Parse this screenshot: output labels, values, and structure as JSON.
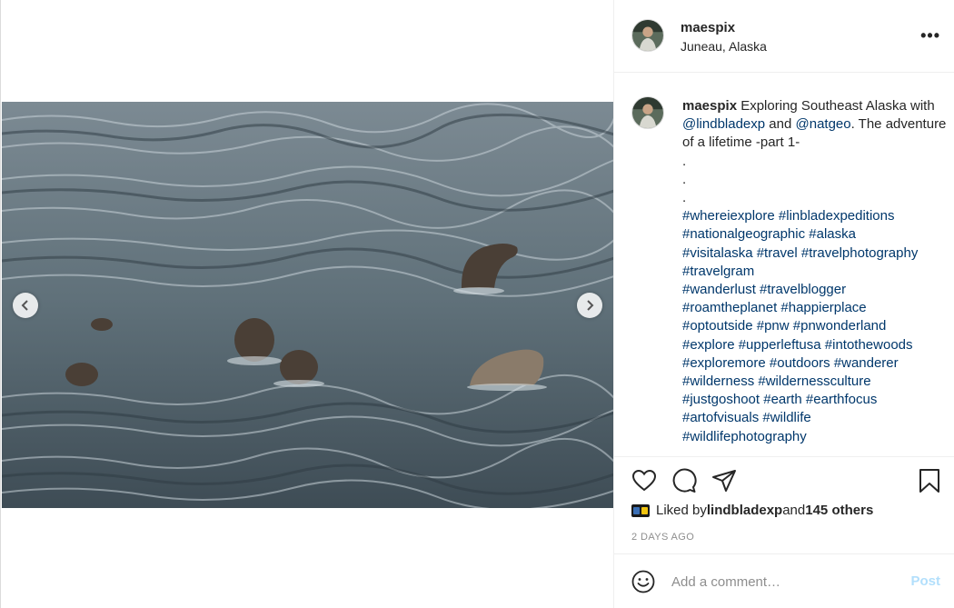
{
  "post": {
    "username": "maespix",
    "location": "Juneau, Alaska",
    "more_label": "•••"
  },
  "caption": {
    "username": "maespix",
    "text_1": " Exploring Southeast Alaska with ",
    "mention_1": "@lindbladexp",
    "text_2": " and ",
    "mention_2": "@natgeo",
    "text_3": ". The adventure of a lifetime -part 1-",
    "dots": [
      ".",
      ".",
      "."
    ],
    "hashtag_lines": [
      "#whereiexplore #linbladexpeditions",
      "#nationalgeographic #alaska",
      "#visitalaska #travel #travelphotography",
      "#travelgram",
      "#wanderlust #travelblogger",
      "#roamtheplanet #happierplace",
      "#optoutside #pnw #pnwonderland",
      "#explore #upperleftusa #intothewoods",
      "#exploremore #outdoors #wanderer",
      "#wilderness #wildernessculture",
      "#justgoshoot #earth #earthfocus",
      "#artofvisuals #wildlife",
      "#wildlifephotography"
    ]
  },
  "likes": {
    "prefix": "Liked by ",
    "user": "lindbladexp",
    "middle": " and ",
    "others": "145 others"
  },
  "timestamp": "2 DAYS AGO",
  "comment": {
    "placeholder": "Add a comment…",
    "post_label": "Post"
  },
  "icons": {
    "prev": "chevron-left-icon",
    "next": "chevron-right-icon",
    "like": "heart-icon",
    "comment": "comment-bubble-icon",
    "share": "paper-plane-icon",
    "save": "bookmark-icon",
    "emoji": "smiley-icon",
    "more": "ellipsis-icon"
  },
  "colors": {
    "link": "#00376b",
    "muted": "#8e8e8e",
    "post_disabled": "#b2dffc"
  }
}
